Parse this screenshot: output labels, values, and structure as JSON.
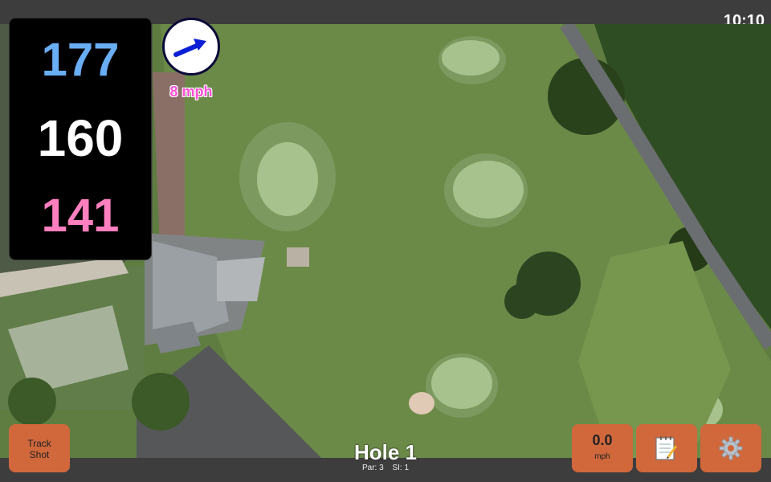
{
  "status": {
    "time": "10:10"
  },
  "yardages": {
    "back": "177",
    "middle": "160",
    "front": "141"
  },
  "wind": {
    "speed_text": "8 mph",
    "icon": "wind-direction-arrow"
  },
  "hole": {
    "title": "Hole 1",
    "par_label": "Par: 3",
    "si_label": "SI: 1"
  },
  "buttons": {
    "track_line1": "Track",
    "track_line2": "Shot",
    "speed_value": "0.0",
    "speed_unit": "mph",
    "notes_icon": "notepad-icon",
    "settings_icon": "gear-icon"
  },
  "colors": {
    "button": "#d0683c",
    "back_yardage": "#69aef5",
    "middle_yardage": "#ffffff",
    "front_yardage": "#ff7fbf",
    "wind_text": "#ff4fd6"
  }
}
